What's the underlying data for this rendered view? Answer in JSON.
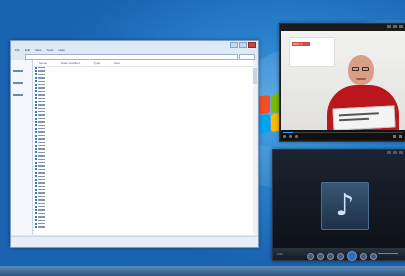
{
  "desktop": {
    "accent": "#2b83cf",
    "logo_colors": [
      "#f25022",
      "#7fba00",
      "#00a4ef",
      "#ffb900"
    ]
  },
  "explorer": {
    "menu": [
      "File",
      "Edit",
      "View",
      "Tools",
      "Help"
    ],
    "columns": [
      "Name",
      "Date modified",
      "Type",
      "Size"
    ],
    "file_rows": 48
  },
  "video_window": {
    "slide_title": "PART 4",
    "brand_color": "#b9161e",
    "progress_fraction": 0.08
  },
  "media_player": {
    "time": "0:00",
    "album_icon": "music-note-icon",
    "note_glyph": "♪"
  }
}
